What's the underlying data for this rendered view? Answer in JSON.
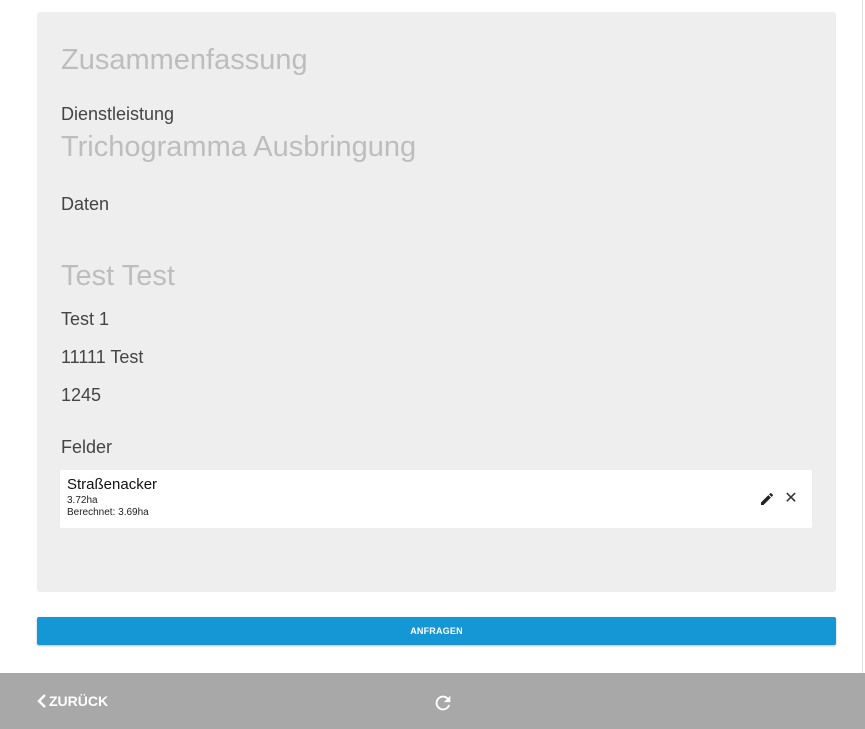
{
  "summary": {
    "title": "Zusammenfassung",
    "service_label": "Dienstleistung",
    "service_value": "Trichogramma Ausbringung",
    "data_label": "Daten",
    "person_name": "Test Test",
    "address_line1": "Test 1",
    "address_line2": "11111 Test",
    "number": "1245",
    "fields_label": "Felder",
    "fields": [
      {
        "name": "Straßenacker",
        "area": "3.72ha",
        "calculated": "Berechnet: 3.69ha",
        "close_glyph": "✕"
      }
    ]
  },
  "actions": {
    "request_label": "ANFRAGEN"
  },
  "footer": {
    "back_label": "ZURÜCK",
    "back_icon": "chevron-left-icon",
    "reload_icon": "reload-icon"
  },
  "colors": {
    "card_bg": "#eeeeee",
    "heading": "#bdbdbd",
    "accent": "#1597d6",
    "footer_bg": "#a8a8a8"
  }
}
